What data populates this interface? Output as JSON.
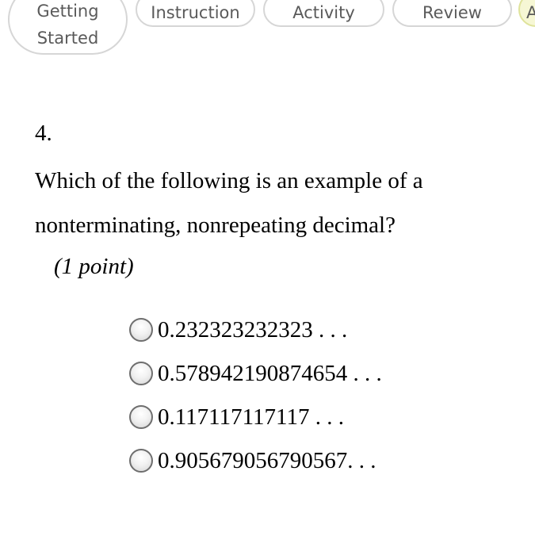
{
  "tabs": [
    {
      "label_line1": "Getting",
      "label_line2": "Started"
    },
    {
      "label": "Instruction"
    },
    {
      "label": "Activity"
    },
    {
      "label": "Review"
    },
    {
      "label": "A",
      "state": "active",
      "color": "#f6f7d4"
    }
  ],
  "question": {
    "number": "4.",
    "text": "Which of the following is an example of a nonterminating, nonrepeating decimal?",
    "points": "(1 point)",
    "options": [
      {
        "label": "0.232323232323 . . .",
        "selected": false
      },
      {
        "label": "0.578942190874654 . . .",
        "selected": false
      },
      {
        "label": "0.117117117117 . . .",
        "selected": false
      },
      {
        "label": "0.905679056790567. . .",
        "selected": false
      }
    ]
  }
}
